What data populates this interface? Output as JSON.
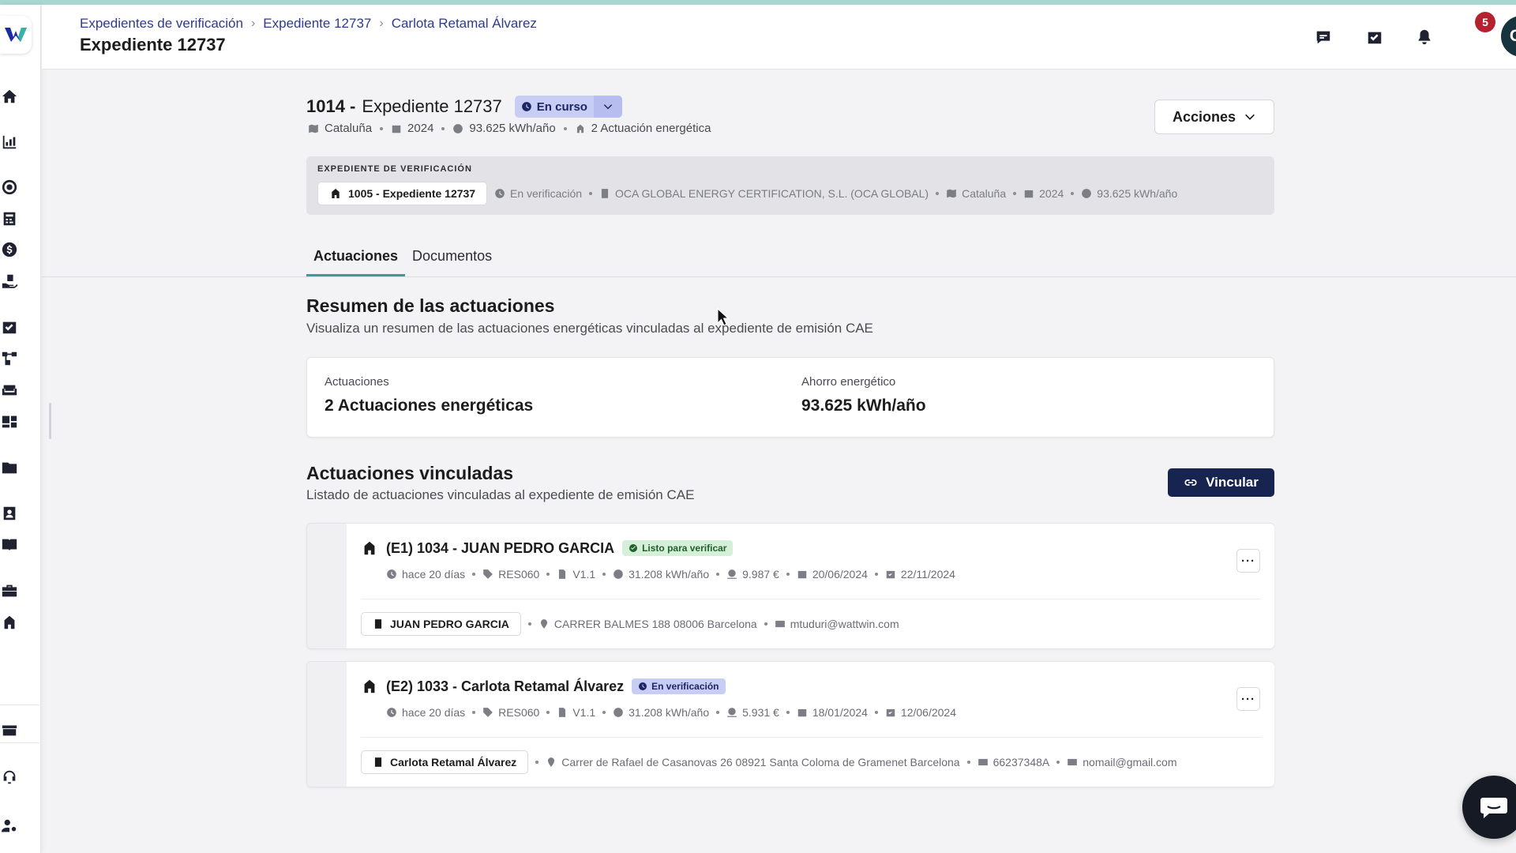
{
  "breadcrumb": {
    "items": [
      "Expedientes de verificación",
      "Expediente 12737",
      "Carlota Retamal Álvarez"
    ]
  },
  "header": {
    "title": "Expediente 12737",
    "notification_count": "5",
    "avatar_initials": "CR"
  },
  "expediente": {
    "id": "1014 -",
    "name": "Expediente 12737",
    "status": "En curso",
    "meta": {
      "region": "Cataluña",
      "year": "2024",
      "energy": "93.625 kWh/año",
      "actuaciones": "2 Actuación energética"
    },
    "actions_label": "Acciones"
  },
  "verification": {
    "label": "EXPEDIENTE DE VERIFICACIÓN",
    "chip": "1005 - Expediente 12737",
    "status": "En verificación",
    "company": "OCA GLOBAL ENERGY CERTIFICATION, S.L. (OCA GLOBAL)",
    "region": "Cataluña",
    "year": "2024",
    "energy": "93.625 kWh/año"
  },
  "tabs": [
    "Actuaciones",
    "Documentos"
  ],
  "summary": {
    "title": "Resumen de las actuaciones",
    "subtitle": "Visualiza un resumen de las actuaciones energéticas vinculadas al expediente de emisión CAE",
    "actuaciones_label": "Actuaciones",
    "actuaciones_value": "2 Actuaciones energéticas",
    "ahorro_label": "Ahorro energético",
    "ahorro_value": "93.625 kWh/año"
  },
  "linked": {
    "title": "Actuaciones vinculadas",
    "subtitle": "Listado de actuaciones vinculadas al expediente de emisión CAE",
    "vincular_label": "Vincular",
    "items": [
      {
        "title": "(E1) 1034 - JUAN PEDRO GARCIA",
        "badge": "Listo para verificar",
        "badge_color": "#d6efd8",
        "time": "hace 20 días",
        "code": "RES060",
        "version": "V1.1",
        "energy": "31.208 kWh/año",
        "amount": "9.987 €",
        "date_start": "20/06/2024",
        "date_end": "22/11/2024",
        "owner": "JUAN PEDRO GARCIA",
        "address": "CARRER BALMES 188 08006 Barcelona",
        "nif": "",
        "email": "mtuduri@wattwin.com"
      },
      {
        "title": "(E2) 1033 - Carlota Retamal Álvarez",
        "badge": "En verificación",
        "badge_color": "#c8cdf3",
        "time": "hace 20 días",
        "code": "RES060",
        "version": "V1.1",
        "energy": "31.208 kWh/año",
        "amount": "5.931 €",
        "date_start": "18/01/2024",
        "date_end": "12/06/2024",
        "owner": "Carlota Retamal Álvarez",
        "address": "Carrer de Rafael de Casanovas 26 08921 Santa Coloma de Gramenet Barcelona",
        "nif": "66237348A",
        "email": "nomail@gmail.com"
      }
    ]
  },
  "colors": {
    "accent": "#3a9aa1",
    "primary_button": "#17244f",
    "status_pill": "#c8cdf3",
    "notification": "#b3222e",
    "avatar": "#16343f"
  }
}
